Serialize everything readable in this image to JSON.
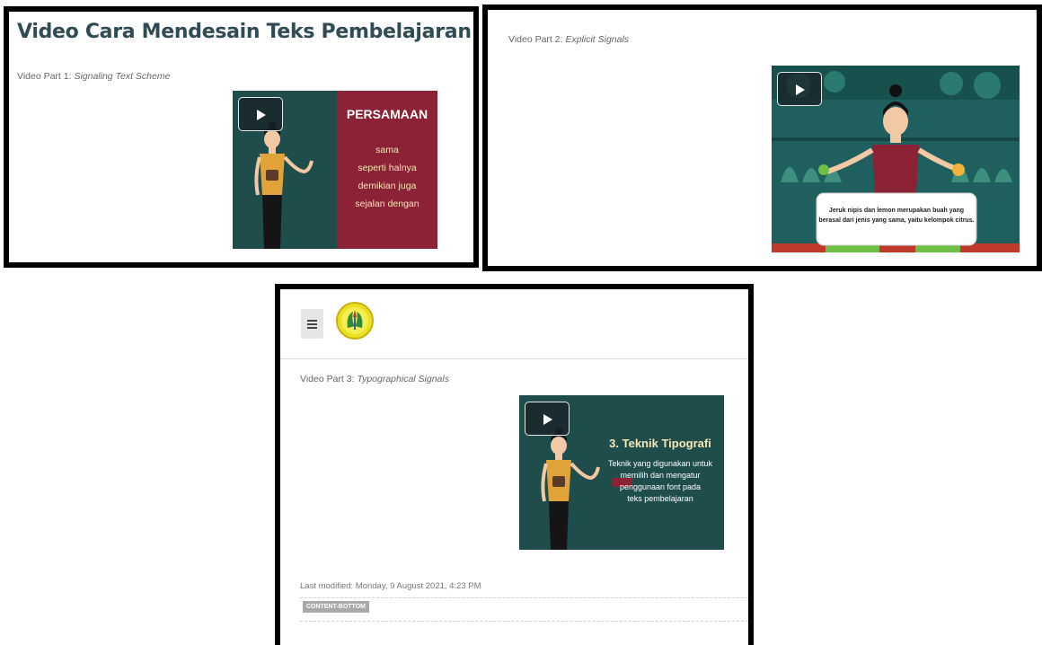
{
  "panel1": {
    "heading": "Video Cara Mendesain Teks Pembelajaran",
    "part_prefix": "Video Part 1: ",
    "part_title": "Signaling Text Scheme",
    "slide": {
      "title": "PERSAMAAN",
      "lines": [
        "sama",
        "seperti halnya",
        "demikian juga",
        "sejalan dengan"
      ]
    }
  },
  "panel2": {
    "part_prefix": "Video Part 2: ",
    "part_title": "Explicit Signals",
    "caption_line1": "Jeruk nipis dan lemon merupakan buah yang",
    "caption_line2": "berasal dari jenis yang sama, yaitu kelompok citrus."
  },
  "panel3": {
    "part_prefix": "Video Part 3: ",
    "part_title": "Typographical Signals",
    "slide": {
      "title": "3. Teknik Tipografi",
      "lines": [
        "Teknik yang digunakan untuk",
        "memilih dan mengatur",
        "penggunaan font pada",
        "teks pembelajaran"
      ]
    },
    "last_modified": "Last modified: Monday, 9 August 2021, 4:23 PM",
    "region_label": "CONTENT-BOTTOM"
  },
  "colors": {
    "heading": "#2f4b55",
    "video_teal": "#1f4d4c",
    "slide_maroon": "#8c2236",
    "slide_text": "#f6e7b5"
  },
  "icons": [
    "play-icon",
    "hamburger-menu-icon",
    "university-logo-icon"
  ]
}
